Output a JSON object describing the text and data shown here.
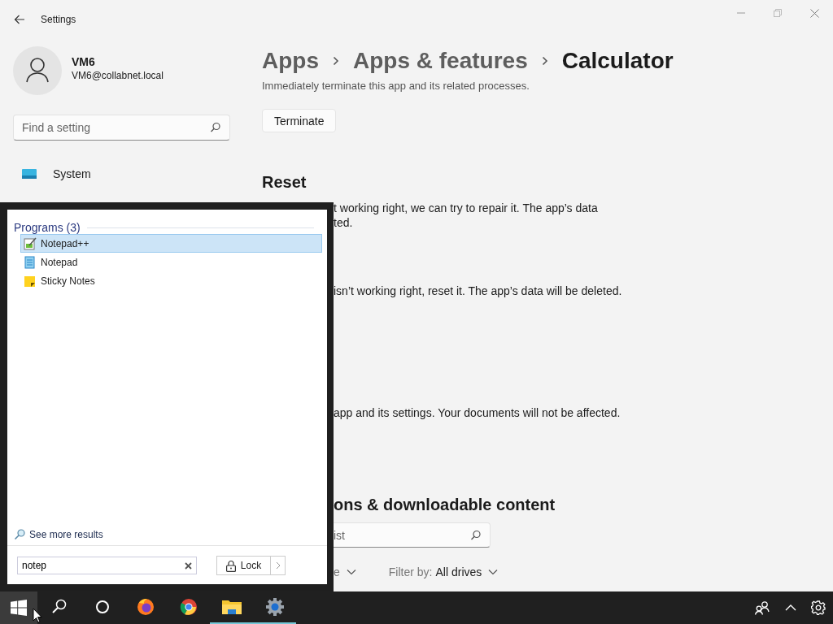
{
  "window": {
    "title": "Settings"
  },
  "user": {
    "name": "VM6",
    "email": "VM6@collabnet.local"
  },
  "sidebar": {
    "search_placeholder": "Find a setting",
    "items": [
      {
        "label": "System"
      }
    ]
  },
  "breadcrumb": [
    "Apps",
    "Apps & features",
    "Calculator"
  ],
  "content": [
    {
      "kind": "text",
      "text": "Immediately terminate this app and its related processes."
    },
    {
      "kind": "button",
      "text": "Terminate"
    },
    {
      "kind": "heading",
      "text": "Reset"
    },
    {
      "kind": "fragment",
      "text": "t working right, we can try to repair it. The app’s data"
    },
    {
      "kind": "fragment",
      "text": "ted."
    },
    {
      "kind": "fragment",
      "text": "isn’t working right, reset it. The app’s data will be deleted."
    },
    {
      "kind": "fragment",
      "text": "app and its settings. Your documents will not be affected."
    },
    {
      "kind": "fragment_heading",
      "text": "ons & downloadable content"
    },
    {
      "kind": "search",
      "placeholder": "ist"
    },
    {
      "kind": "filters",
      "items": [
        {
          "label": "e"
        },
        {
          "label": "Filter by:",
          "value": "All drives"
        }
      ]
    }
  ],
  "start_menu": {
    "section": "Programs (3)",
    "items": [
      {
        "label": "Notepad++",
        "selected": true
      },
      {
        "label": "Notepad",
        "selected": false
      },
      {
        "label": "Sticky Notes",
        "selected": false
      }
    ],
    "see_more": "See more results",
    "search_value": "notep",
    "power_button": "Lock"
  },
  "taskbar": {
    "start": {
      "selected": true
    },
    "apps": [
      {
        "running": false
      },
      {
        "running": false
      },
      {
        "running": false
      },
      {
        "running": false
      },
      {
        "running": true
      },
      {
        "running": true
      }
    ]
  }
}
